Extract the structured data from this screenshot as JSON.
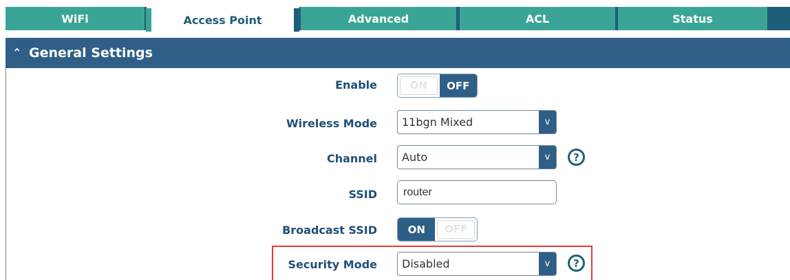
{
  "tabs": [
    {
      "label": "WiFi"
    },
    {
      "label": "Access Point"
    },
    {
      "label": "Advanced"
    },
    {
      "label": "ACL"
    },
    {
      "label": "Status"
    }
  ],
  "active_tab": "Access Point",
  "section": {
    "title": "General Settings",
    "caret_icon": "chevron-up-icon"
  },
  "fields": {
    "enable": {
      "label": "Enable",
      "on_label": "ON",
      "off_label": "OFF",
      "state": "OFF"
    },
    "wireless_mode": {
      "label": "Wireless Mode",
      "value": "11bgn Mixed",
      "dropdown_glyph": "v"
    },
    "channel": {
      "label": "Channel",
      "value": "Auto",
      "dropdown_glyph": "v",
      "help_glyph": "?"
    },
    "ssid": {
      "label": "SSID",
      "value": "router"
    },
    "broadcast_ssid": {
      "label": "Broadcast SSID",
      "on_label": "ON",
      "off_label": "OFF",
      "state": "ON"
    },
    "security_mode": {
      "label": "Security Mode",
      "value": "Disabled",
      "dropdown_glyph": "v",
      "help_glyph": "?"
    }
  },
  "colors": {
    "tab_teal": "#3aa596",
    "header_blue": "#2f5f86",
    "label_blue": "#1f4f76",
    "highlight_red": "#e53935"
  }
}
